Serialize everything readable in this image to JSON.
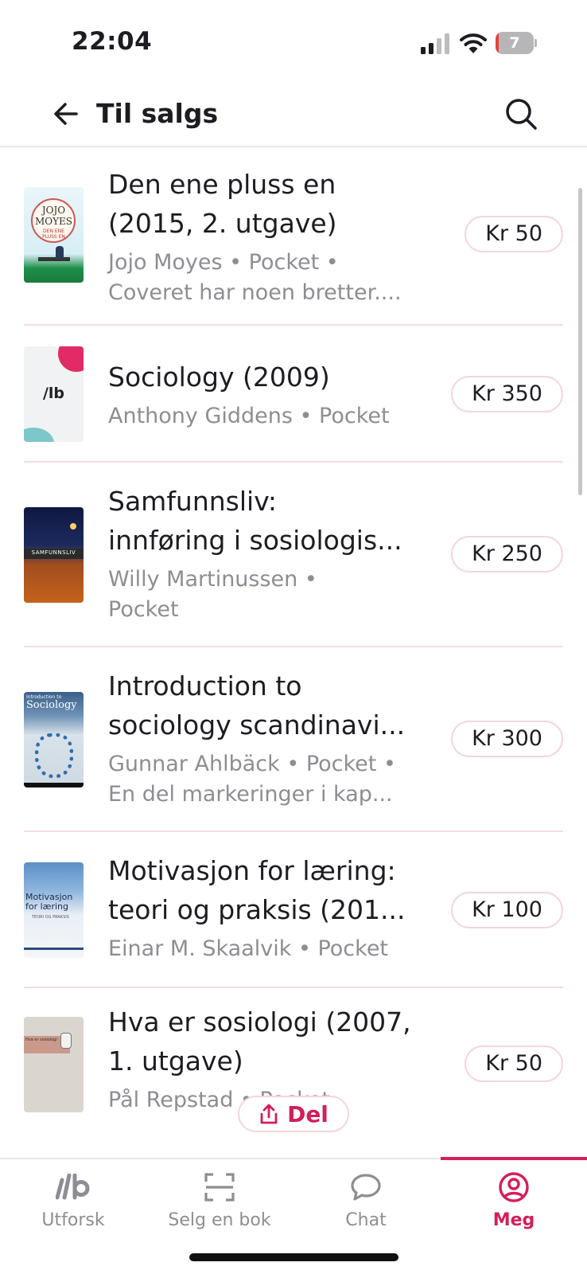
{
  "status_bar": {
    "time": "22:04",
    "battery_level": "7",
    "battery_fraction": 0.07,
    "icons": [
      "signal-icon",
      "wifi-icon",
      "battery-icon"
    ]
  },
  "header": {
    "title": "Til salgs",
    "back_icon": "arrow-left-icon",
    "search_icon": "search-icon"
  },
  "listings": [
    {
      "title_line1": "Den ene pluss en",
      "title_line2": "(2015, 2. utgave)",
      "sub_line1": "Jojo Moyes • Pocket •",
      "sub_line2": "Coveret har noen bretter....",
      "price": "Kr 50",
      "cover_text": "JOJO MOYES",
      "cover_subtext": "DEN ENE PLUSS EN"
    },
    {
      "title_line1": "Sociology (2009)",
      "title_line2": "",
      "sub_line1": "Anthony Giddens • Pocket",
      "sub_line2": "",
      "price": "Kr 350",
      "cover_text": "/lb",
      "cover_subtext": ""
    },
    {
      "title_line1": "Samfunnsliv:",
      "title_line2": "innføring i sosiologis...",
      "sub_line1": "Willy Martinussen •",
      "sub_line2": "Pocket",
      "price": "Kr 250",
      "cover_text": "SAMFUNNSLIV",
      "cover_subtext": ""
    },
    {
      "title_line1": "Introduction to",
      "title_line2": "sociology scandinavi...",
      "sub_line1": "Gunnar Ahlbäck • Pocket •",
      "sub_line2": "En del markeringer i kap...",
      "price": "Kr 300",
      "cover_text": "Sociology",
      "cover_subtext": "Introduction to"
    },
    {
      "title_line1": "Motivasjon for læring:",
      "title_line2": "teori og praksis (201...",
      "sub_line1": "Einar M. Skaalvik • Pocket",
      "sub_line2": "",
      "price": "Kr 100",
      "cover_text": "Motivasjon for læring",
      "cover_subtext": "TEORI OG PRAKSIS"
    },
    {
      "title_line1": "Hva er sosiologi (2007,",
      "title_line2": "1. utgave)",
      "sub_line1": "Pål Repstad • Pocket",
      "sub_line2": "",
      "price": "Kr 50",
      "cover_text": "Hva er sosiologi",
      "cover_subtext": ""
    }
  ],
  "share_button": {
    "label": "Del",
    "icon": "share-icon"
  },
  "bottom_nav": {
    "items": [
      {
        "label": "Utforsk",
        "icon": "logo-icon",
        "active": false
      },
      {
        "label": "Selg en bok",
        "icon": "scan-icon",
        "active": false
      },
      {
        "label": "Chat",
        "icon": "chat-bubble-icon",
        "active": false
      },
      {
        "label": "Meg",
        "icon": "user-circle-icon",
        "active": true
      }
    ],
    "accent_color": "#d21f5a",
    "inactive_color": "#8d8d93"
  }
}
